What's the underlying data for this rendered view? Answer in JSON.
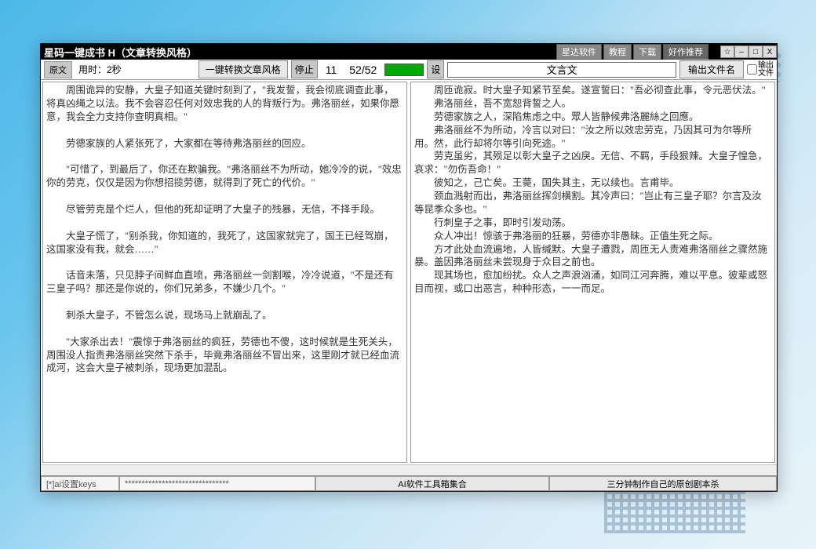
{
  "titlebar": {
    "title": "星码一键成书 H（文章转换风格）",
    "buttons": [
      "星达软件",
      "教程",
      "下载"
    ],
    "recommend": "好作推荐",
    "min": "☆",
    "mid": "–",
    "max": "□",
    "close": "X"
  },
  "toolbar": {
    "tab": "原文",
    "timer": "用时：2秒",
    "convert": "一键转换文章风格",
    "stop": "停止",
    "count": "11",
    "ratio": "52/52",
    "set": "设",
    "style_input": "文言文",
    "output_btn": "输出文件名",
    "checkbox_text1": "输出",
    "checkbox_text2": "文件"
  },
  "left_text": "　　周围诡异的安静，大皇子知道关键时刻到了，\"我发誓，我会彻底调查此事，将真凶绳之以法。我不会容忍任何对效忠我的人的背叛行为。弗洛丽丝，如果你愿意，我会全力支持你查明真相。\"\n\n　　劳德家族的人紧张死了，大家都在等待弗洛丽丝的回应。\n\n　　\"可惜了，到最后了，你还在欺骗我。\"弗洛丽丝不为所动，她冷冷的说，\"效忠你的劳克，仅仅是因为你想招揽劳德，就得到了死亡的代价。\"\n\n　　尽管劳克是个烂人，但他的死却证明了大皇子的残暴，无信，不择手段。\n\n　　大皇子慌了，\"别杀我，你知道的，我死了，这国家就完了，国王已经驾崩，这国家没有我，就会……\"\n\n　　话音未落，只见脖子间鲜血直喷，弗洛丽丝一剑割喉，冷冷说道，\"不是还有三皇子吗？那还是你说的，你们兄弟多，不嫌少几个。\"\n\n　　刺杀大皇子，不管怎么说，现场马上就崩乱了。\n\n　　\"大家杀出去！\"震惊于弗洛丽丝的疯狂，劳德也不傻，这时候就是生死关头，周围没人指责弗洛丽丝突然下杀手，毕竟弗洛丽丝不冒出来，这里刚才就已经血流成河，这会大皇子被刺杀，现场更加混乱。",
  "right_text": "　　周匝诡寂。时大皇子知紧节至矣。遂宣誓曰：\"吾必彻查此事，令元恶伏法。\"\n　　弗洛丽丝，吾不宽恕背誓之人。\n　　劳德家族之人，深陷焦虑之中。眾人皆静候弗洛麗絲之回應。\n　　弗洛丽丝不为所动，冷言以对曰：\"汝之所以效忠劳克，乃因其可为尔等所用。然，此行却将尔等引向死途。\"\n　　劳克虽劣，其殒足以彰大皇子之凶戾。无信、不羁，手段狠辣。大皇子惶急，哀求：\"勿伤吾命！\"\n　　彼知之，己亡矣。王薨，国失其主，无以续也。言甫毕。\n　　颈血溅射而出，弗洛丽丝挥剑横割。其冷声曰：\"岂止有三皇子耶？尔言及汝等昆季众多也。\"\n　　行刺皇子之事，即时引发动荡。\n　　众人冲出！惊骇于弗洛丽的狂暴，劳德亦非愚昧。正值生死之际。\n　　方才此处血流遍地，人皆缄默。大皇子遭戮，周匝无人责难弗洛丽丝之骤然施暴。盖因弗洛丽丝未尝现身于众目之前也。\n　　现其场也，愈加纷扰。众人之声浪汹涌，如同江河奔腾，难以平息。彼辈或怒目而视，或口出恶言，种种形态，一一而足。",
  "bottom": {
    "keys": "[*]ai设置keys",
    "stars": "*******************************",
    "center": "AI软件工具箱集合",
    "right": "三分钟制作自己的原创剧本杀"
  }
}
